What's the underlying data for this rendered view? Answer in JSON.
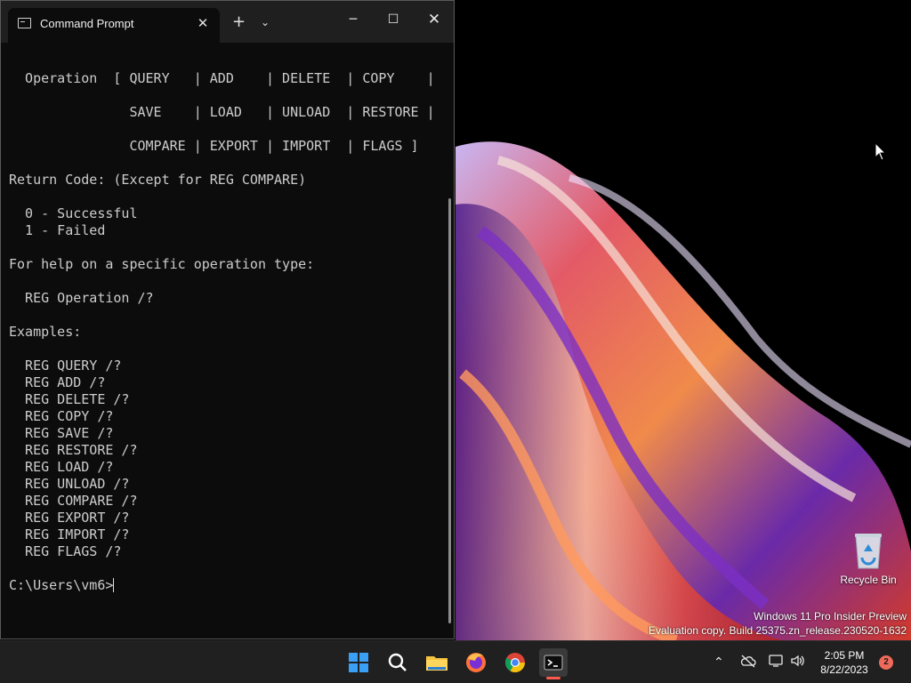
{
  "window": {
    "tab_title": "Command Prompt",
    "console_lines": [
      "",
      "  Operation  [ QUERY   | ADD    | DELETE  | COPY    |",
      "",
      "               SAVE    | LOAD   | UNLOAD  | RESTORE |",
      "",
      "               COMPARE | EXPORT | IMPORT  | FLAGS ]",
      "",
      "Return Code: (Except for REG COMPARE)",
      "",
      "  0 - Successful",
      "  1 - Failed",
      "",
      "For help on a specific operation type:",
      "",
      "  REG Operation /?",
      "",
      "Examples:",
      "",
      "  REG QUERY /?",
      "  REG ADD /?",
      "  REG DELETE /?",
      "  REG COPY /?",
      "  REG SAVE /?",
      "  REG RESTORE /?",
      "  REG LOAD /?",
      "  REG UNLOAD /?",
      "  REG COMPARE /?",
      "  REG EXPORT /?",
      "  REG IMPORT /?",
      "  REG FLAGS /?",
      ""
    ],
    "prompt": "C:\\Users\\vm6>"
  },
  "desktop": {
    "recycle_bin_label": "Recycle Bin",
    "watermark_line1": "Windows 11 Pro Insider Preview",
    "watermark_line2": "Evaluation copy. Build 25375.zn_release.230520-1632"
  },
  "taskbar": {
    "pinned": [
      "start-icon",
      "search-icon",
      "file-explorer-icon",
      "firefox-icon",
      "chrome-icon",
      "terminal-icon"
    ],
    "time": "2:05 PM",
    "date": "8/22/2023",
    "notification_count": "2"
  },
  "colors": {
    "terminal_bg": "#0c0c0c",
    "terminal_text": "#cccccc",
    "titlebar_bg": "#1f1f1f",
    "taskbar_bg": "#202020",
    "badge": "#ef6a5a"
  }
}
